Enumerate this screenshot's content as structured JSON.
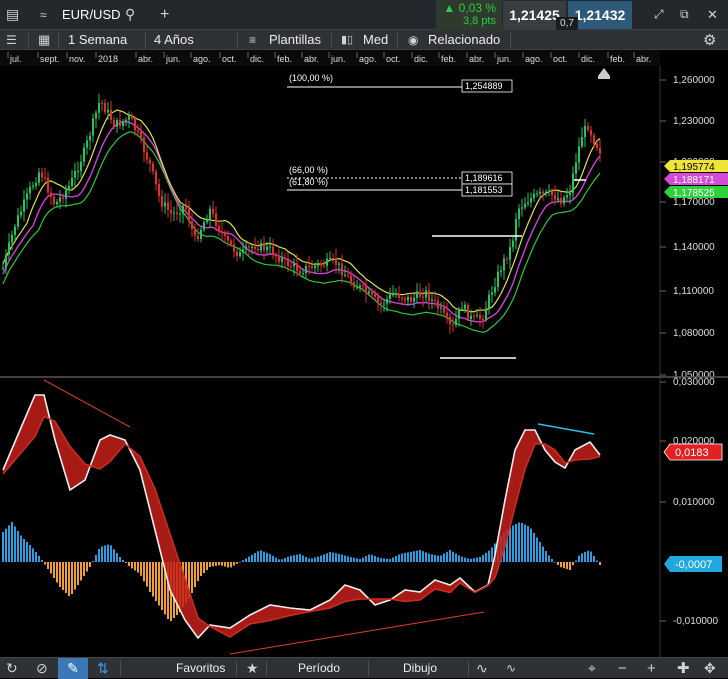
{
  "header": {
    "symbol": "EUR/USD",
    "change_pct": "0,03 %",
    "change_pts": "3,8 pts",
    "bid": "1,21425",
    "ask": "1,21432",
    "spread": "0,7"
  },
  "toolbar": {
    "period": "1 Semana",
    "range": "4 Años",
    "templates": "Plantillas",
    "candle_type": "Med",
    "related": "Relacionado"
  },
  "time_axis": [
    "jul.",
    "sept.",
    "nov.",
    "2018",
    "abr.",
    "jun.",
    "ago.",
    "oct.",
    "dic.",
    "feb.",
    "abr.",
    "jun.",
    "ago.",
    "oct.",
    "dic.",
    "feb.",
    "abr.",
    "jun.",
    "ago.",
    "oct.",
    "dic.",
    "feb.",
    "abr."
  ],
  "price_axis": [
    "1,260000",
    "1,230000",
    "1,200000",
    "1,170000",
    "1,140000",
    "1,110000",
    "1,080000",
    "1,050000"
  ],
  "price_tags": {
    "tag1": "1,195774",
    "tag2": "1,188171",
    "tag3": "1,178525"
  },
  "fib": {
    "l100_label": "(100,00 %)",
    "l100_value": "1,254889",
    "l66_label": "(66,00 %)",
    "l66_value": "1,189616",
    "l618_label": "(61,80 %)",
    "l618_value": "1,181553"
  },
  "macd_axis": [
    "0,030000",
    "0,020000",
    "0,010000",
    "-0,010000"
  ],
  "macd_tags": {
    "signal": "0,0183",
    "hist": "-0,0007"
  },
  "colors": {
    "up": "#22c55e",
    "down": "#e0302a",
    "ma_yellow": "#e6e04a",
    "ma_magenta": "#d040d8",
    "ma_green": "#28c93a",
    "hist_up": "#2a9ee0",
    "hist_down": "#f0a030"
  },
  "bottom": {
    "favorites": "Favoritos",
    "period": "Período",
    "drawing": "Dibujo"
  }
}
